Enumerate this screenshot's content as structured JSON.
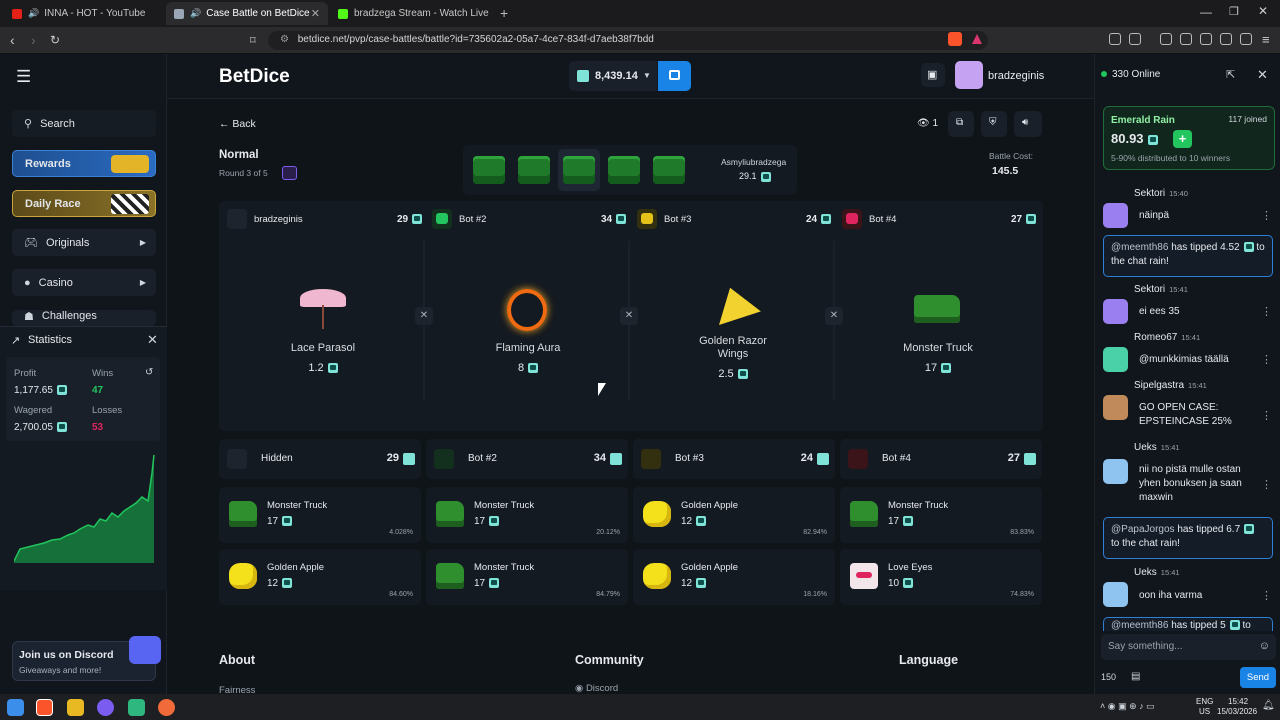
{
  "browser": {
    "tabs": [
      {
        "title": "INNA - HOT - YouTube",
        "active": false
      },
      {
        "title": "Case Battle on BetDice",
        "active": true
      },
      {
        "title": "bradzega Stream - Watch Live on Kic",
        "active": false
      }
    ],
    "url": "betdice.net/pvp/case-battles/battle?id=735602a2-05a7-4ce7-834f-d7aeb38f7bdd"
  },
  "header": {
    "logo": "BetDice",
    "balance": "8,439.14",
    "username": "bradzeginis"
  },
  "sidebar": {
    "search_label": "Search",
    "rewards_label": "Rewards",
    "daily_race_label": "Daily Race",
    "items": [
      {
        "label": "Originals"
      },
      {
        "label": "Casino"
      },
      {
        "label": "Challenges"
      }
    ],
    "stats": {
      "title": "Statistics",
      "profit_label": "Profit",
      "profit_value": "1,177.65",
      "wins_label": "Wins",
      "wins_value": "47",
      "wagered_label": "Wagered",
      "wagered_value": "2,700.05",
      "losses_label": "Losses",
      "losses_value": "53"
    },
    "discord": {
      "title": "Join us on Discord",
      "subtitle": "Giveaways and more!"
    }
  },
  "battle": {
    "back_label": "Back",
    "viewers": "1",
    "mode": "Normal",
    "round": "Round 3 of 5",
    "case_name": "Asmyliubradzega",
    "case_value": "29.1",
    "cost_label": "Battle Cost:",
    "cost_value": "145.5",
    "players": [
      {
        "name": "bradzeginis",
        "total": "29",
        "item": "Lace Parasol",
        "value": "1.2"
      },
      {
        "name": "Bot #2",
        "total": "34",
        "item": "Flaming Aura",
        "value": "8"
      },
      {
        "name": "Bot #3",
        "total": "24",
        "item": "Golden Razor Wings",
        "value": "2.5"
      },
      {
        "name": "Bot #4",
        "total": "27",
        "item": "Monster Truck",
        "value": "17"
      }
    ],
    "columns": [
      {
        "name": "Hidden",
        "total": "29",
        "drops": [
          {
            "name": "Monster Truck",
            "value": "17",
            "pct": "4.028%",
            "type": "truck"
          },
          {
            "name": "Golden Apple",
            "value": "12",
            "pct": "84.60%",
            "type": "apple"
          }
        ]
      },
      {
        "name": "Bot #2",
        "total": "34",
        "drops": [
          {
            "name": "Monster Truck",
            "value": "17",
            "pct": "20.12%",
            "type": "truck"
          },
          {
            "name": "Monster Truck",
            "value": "17",
            "pct": "84.79%",
            "type": "truck"
          }
        ]
      },
      {
        "name": "Bot #3",
        "total": "24",
        "drops": [
          {
            "name": "Golden Apple",
            "value": "12",
            "pct": "82.94%",
            "type": "apple"
          },
          {
            "name": "Golden Apple",
            "value": "12",
            "pct": "18.16%",
            "type": "apple"
          }
        ]
      },
      {
        "name": "Bot #4",
        "total": "27",
        "drops": [
          {
            "name": "Monster Truck",
            "value": "17",
            "pct": "83.83%",
            "type": "truck"
          },
          {
            "name": "Love Eyes",
            "value": "10",
            "pct": "74.83%",
            "type": "love"
          }
        ]
      }
    ]
  },
  "footer": {
    "about": "About",
    "fairness": "Fairness",
    "community": "Community",
    "discord": "Discord",
    "language": "Language"
  },
  "chat": {
    "online": "330 Online",
    "rain": {
      "title": "Emerald Rain",
      "joined": "117 joined",
      "amount": "80.93",
      "desc": "5-90% distributed to 10 winners"
    },
    "messages": [
      {
        "user": "Sektori",
        "time": "15:40",
        "text": "näinpä"
      },
      {
        "tip": "@meemth86",
        "tip_text": "has tipped 4.52",
        "tip_tail": "to the chat rain!"
      },
      {
        "user": "Sektori",
        "time": "15:41",
        "text": "ei ees 35"
      },
      {
        "user": "Romeo67",
        "time": "15:41",
        "text": "@munkkimias täällä"
      },
      {
        "user": "Sipelgastra",
        "time": "15:41",
        "text": "GO OPEN CASE: EPSTEINCASE 25%"
      },
      {
        "user": "Ueks",
        "time": "15:41",
        "text": "nii no pistä mulle ostan yhen bonuksen ja saan maxwin"
      },
      {
        "tip": "@PapaJorgos",
        "tip_text": "has tipped 6.7",
        "tip_tail": "to the chat rain!"
      },
      {
        "user": "Ueks",
        "time": "15:41",
        "text": "oon iha varma"
      },
      {
        "tip": "@meemth86",
        "tip_text": "has tipped 5",
        "tip_tail": "to"
      }
    ],
    "placeholder": "Say something...",
    "char_count": "150",
    "send_label": "Send"
  },
  "taskbar": {
    "lang1": "ENG",
    "lang2": "US",
    "time": "15:42",
    "date": "15/03/2026"
  },
  "colors": {
    "accent": "#1a84e6",
    "teal": "#7fe3d8",
    "green": "#22c55e",
    "loss": "#e0245e"
  }
}
